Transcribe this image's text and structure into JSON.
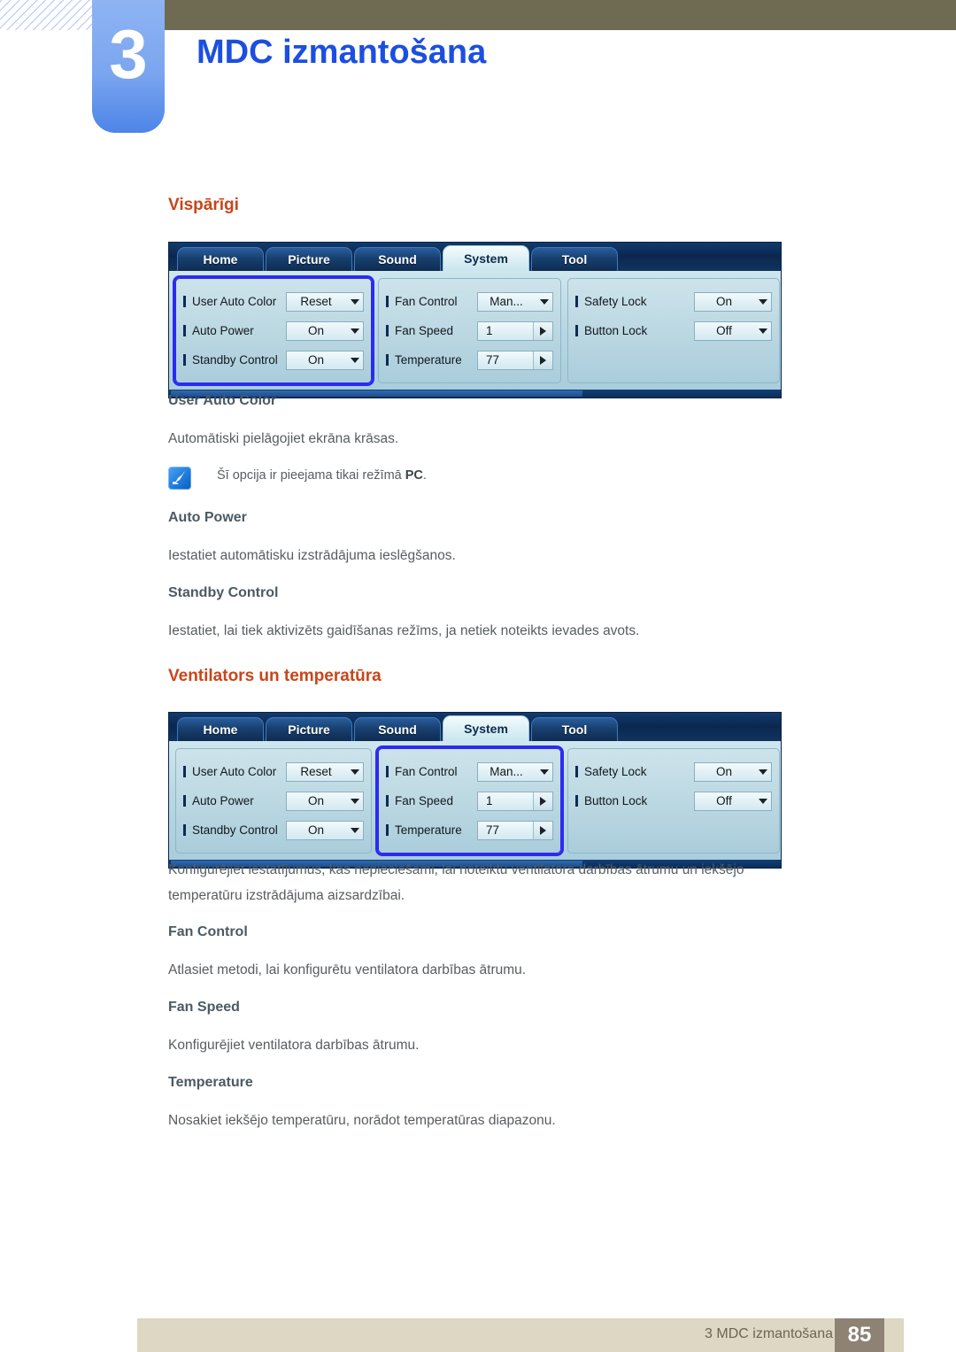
{
  "header": {
    "chapter_number": "3",
    "chapter_title": "MDC izmantošana"
  },
  "sections": {
    "general": {
      "heading": "Vispārīgi",
      "items": [
        {
          "title": "User Auto Color",
          "body": "Automātiski pielāgojiet ekrāna krāsas."
        },
        {
          "title": "Auto Power",
          "body": "Iestatiet automātisku izstrādājuma ieslēgšanos."
        },
        {
          "title": "Standby Control",
          "body": "Iestatiet, lai tiek aktivizēts gaidīšanas režīms, ja netiek noteikts ievades avots."
        }
      ],
      "note": {
        "icon": "note-pen-icon",
        "text_before": "Šī opcija ir pieejama tikai režīmā ",
        "text_bold": "PC",
        "text_after": "."
      }
    },
    "fan": {
      "heading": "Ventilators un temperatūra",
      "intro_line1": "Konfigurējiet iestatījumus, kas nepieciešami, lai noteiktu ventilatora darbības ātrumu un iekšējo",
      "intro_line2": "temperatūru izstrādājuma aizsardzībai.",
      "items": [
        {
          "title": "Fan Control",
          "body": "Atlasiet metodi, lai konfigurētu ventilatora darbības ātrumu."
        },
        {
          "title": "Fan Speed",
          "body": "Konfigurējiet ventilatora darbības ātrumu."
        },
        {
          "title": "Temperature",
          "body": "Nosakiet iekšējo temperatūru, norādot temperatūras diapazonu."
        }
      ]
    }
  },
  "mdc_panel": {
    "tabs": [
      {
        "label": "Home",
        "active": false
      },
      {
        "label": "Picture",
        "active": false
      },
      {
        "label": "Sound",
        "active": false
      },
      {
        "label": "System",
        "active": true
      },
      {
        "label": "Tool",
        "active": false
      }
    ],
    "columns": {
      "column1": [
        {
          "label": "User Auto Color",
          "value": "Reset",
          "control": "dropdown"
        },
        {
          "label": "Auto Power",
          "value": "On",
          "control": "dropdown"
        },
        {
          "label": "Standby Control",
          "value": "On",
          "control": "dropdown"
        }
      ],
      "column2": [
        {
          "label": "Fan Control",
          "value": "Man...",
          "control": "dropdown"
        },
        {
          "label": "Fan Speed",
          "value": "1",
          "control": "spinner"
        },
        {
          "label": "Temperature",
          "value": "77",
          "control": "spinner"
        }
      ],
      "column3": [
        {
          "label": "Safety Lock",
          "value": "On",
          "control": "dropdown"
        },
        {
          "label": "Button Lock",
          "value": "Off",
          "control": "dropdown"
        }
      ]
    },
    "highlight_first": "column1",
    "highlight_second": "column2"
  },
  "footer": {
    "text": "3 MDC izmantošana",
    "page": "85"
  },
  "colors": {
    "accent_orange": "#c9451a",
    "chapter_blue": "#1c4fe0",
    "olive": "#6e6b52",
    "footer_beige": "#ddd7c3",
    "footer_page_box": "#8d8274",
    "highlight_blue": "#2b2bf0"
  }
}
